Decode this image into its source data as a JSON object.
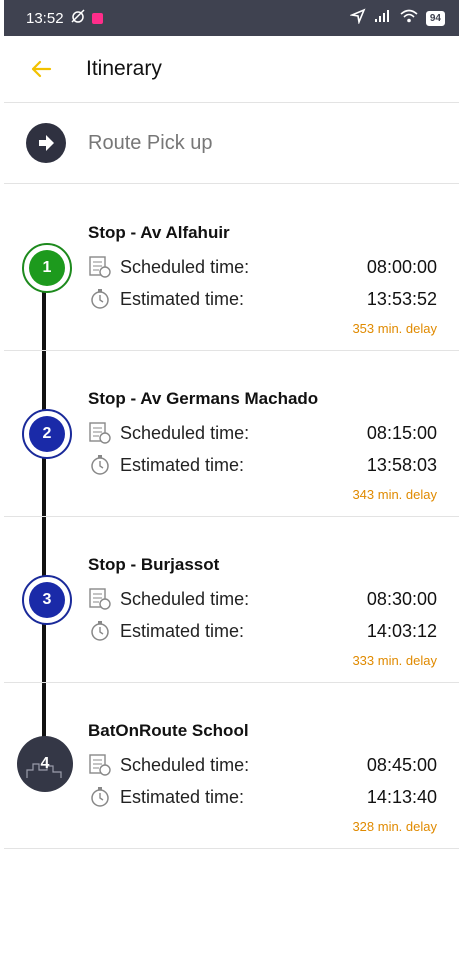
{
  "status_bar": {
    "time": "13:52",
    "battery": "94"
  },
  "header": {
    "title": "Itinerary"
  },
  "route": {
    "label": "Route Pick up"
  },
  "labels": {
    "scheduled": "Scheduled time:",
    "estimated": "Estimated time:"
  },
  "colors": {
    "accent": "#f2c100",
    "delay": "#e08a00",
    "stop_green": "#1d9a1d",
    "stop_blue": "#1a2aa8",
    "school": "#343746"
  },
  "stops": [
    {
      "number": "1",
      "name": "Stop - Av Alfahuir",
      "scheduled": "08:00:00",
      "estimated": "13:53:52",
      "delay": "353 min. delay",
      "marker": "green"
    },
    {
      "number": "2",
      "name": "Stop - Av Germans Machado",
      "scheduled": "08:15:00",
      "estimated": "13:58:03",
      "delay": "343 min. delay",
      "marker": "blue"
    },
    {
      "number": "3",
      "name": "Stop - Burjassot",
      "scheduled": "08:30:00",
      "estimated": "14:03:12",
      "delay": "333 min. delay",
      "marker": "blue"
    },
    {
      "number": "4",
      "name": "BatOnRoute School",
      "scheduled": "08:45:00",
      "estimated": "14:13:40",
      "delay": "328 min. delay",
      "marker": "school"
    }
  ]
}
